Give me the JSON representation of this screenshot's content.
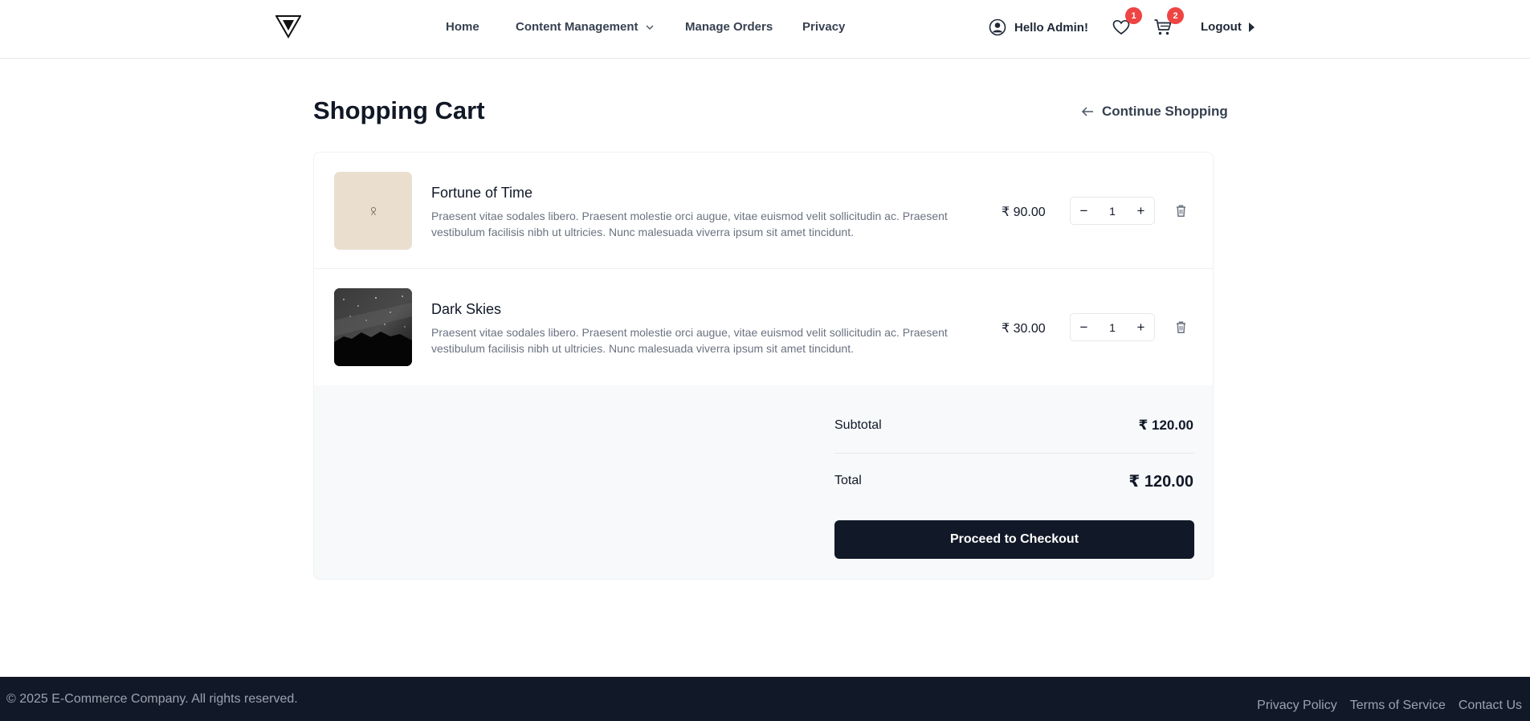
{
  "header": {
    "nav": {
      "home": "Home",
      "content_management": "Content Management",
      "manage_orders": "Manage Orders",
      "privacy": "Privacy"
    },
    "user_greeting": "Hello Admin!",
    "wishlist_count": "1",
    "cart_count": "2",
    "logout": "Logout"
  },
  "page": {
    "title": "Shopping Cart",
    "continue_shopping": "Continue Shopping"
  },
  "cart": {
    "items": [
      {
        "name": "Fortune of Time",
        "description": "Praesent vitae sodales libero. Praesent molestie orci augue, vitae euismod velit sollicitudin ac. Praesent vestibulum facilisis nibh ut ultricies. Nunc malesuada viverra ipsum sit amet tincidunt.",
        "price": "₹ 90.00",
        "quantity": "1"
      },
      {
        "name": "Dark Skies",
        "description": "Praesent vitae sodales libero. Praesent molestie orci augue, vitae euismod velit sollicitudin ac. Praesent vestibulum facilisis nibh ut ultricies. Nunc malesuada viverra ipsum sit amet tincidunt.",
        "price": "₹ 30.00",
        "quantity": "1"
      }
    ],
    "subtotal_label": "Subtotal",
    "subtotal": "₹ 120.00",
    "total_label": "Total",
    "total": "₹ 120.00",
    "checkout_label": "Proceed to Checkout"
  },
  "footer": {
    "copyright": "© 2025 E-Commerce Company. All rights reserved.",
    "links": [
      "Privacy Policy",
      "Terms of Service",
      "Contact Us"
    ]
  },
  "icons": {
    "logo": "triangle-logo-icon",
    "dropdown": "chevron-down-icon",
    "user": "user-circle-icon",
    "wishlist": "heart-icon",
    "cart": "cart-icon",
    "logout": "caret-right-icon",
    "back": "arrow-left-icon",
    "minus": "minus-icon",
    "plus": "plus-icon",
    "delete": "trash-icon"
  },
  "colors": {
    "primary": "#111827",
    "badge": "#ef4444",
    "muted_text": "#6b7280",
    "summary_bg": "#f8f9fb"
  }
}
